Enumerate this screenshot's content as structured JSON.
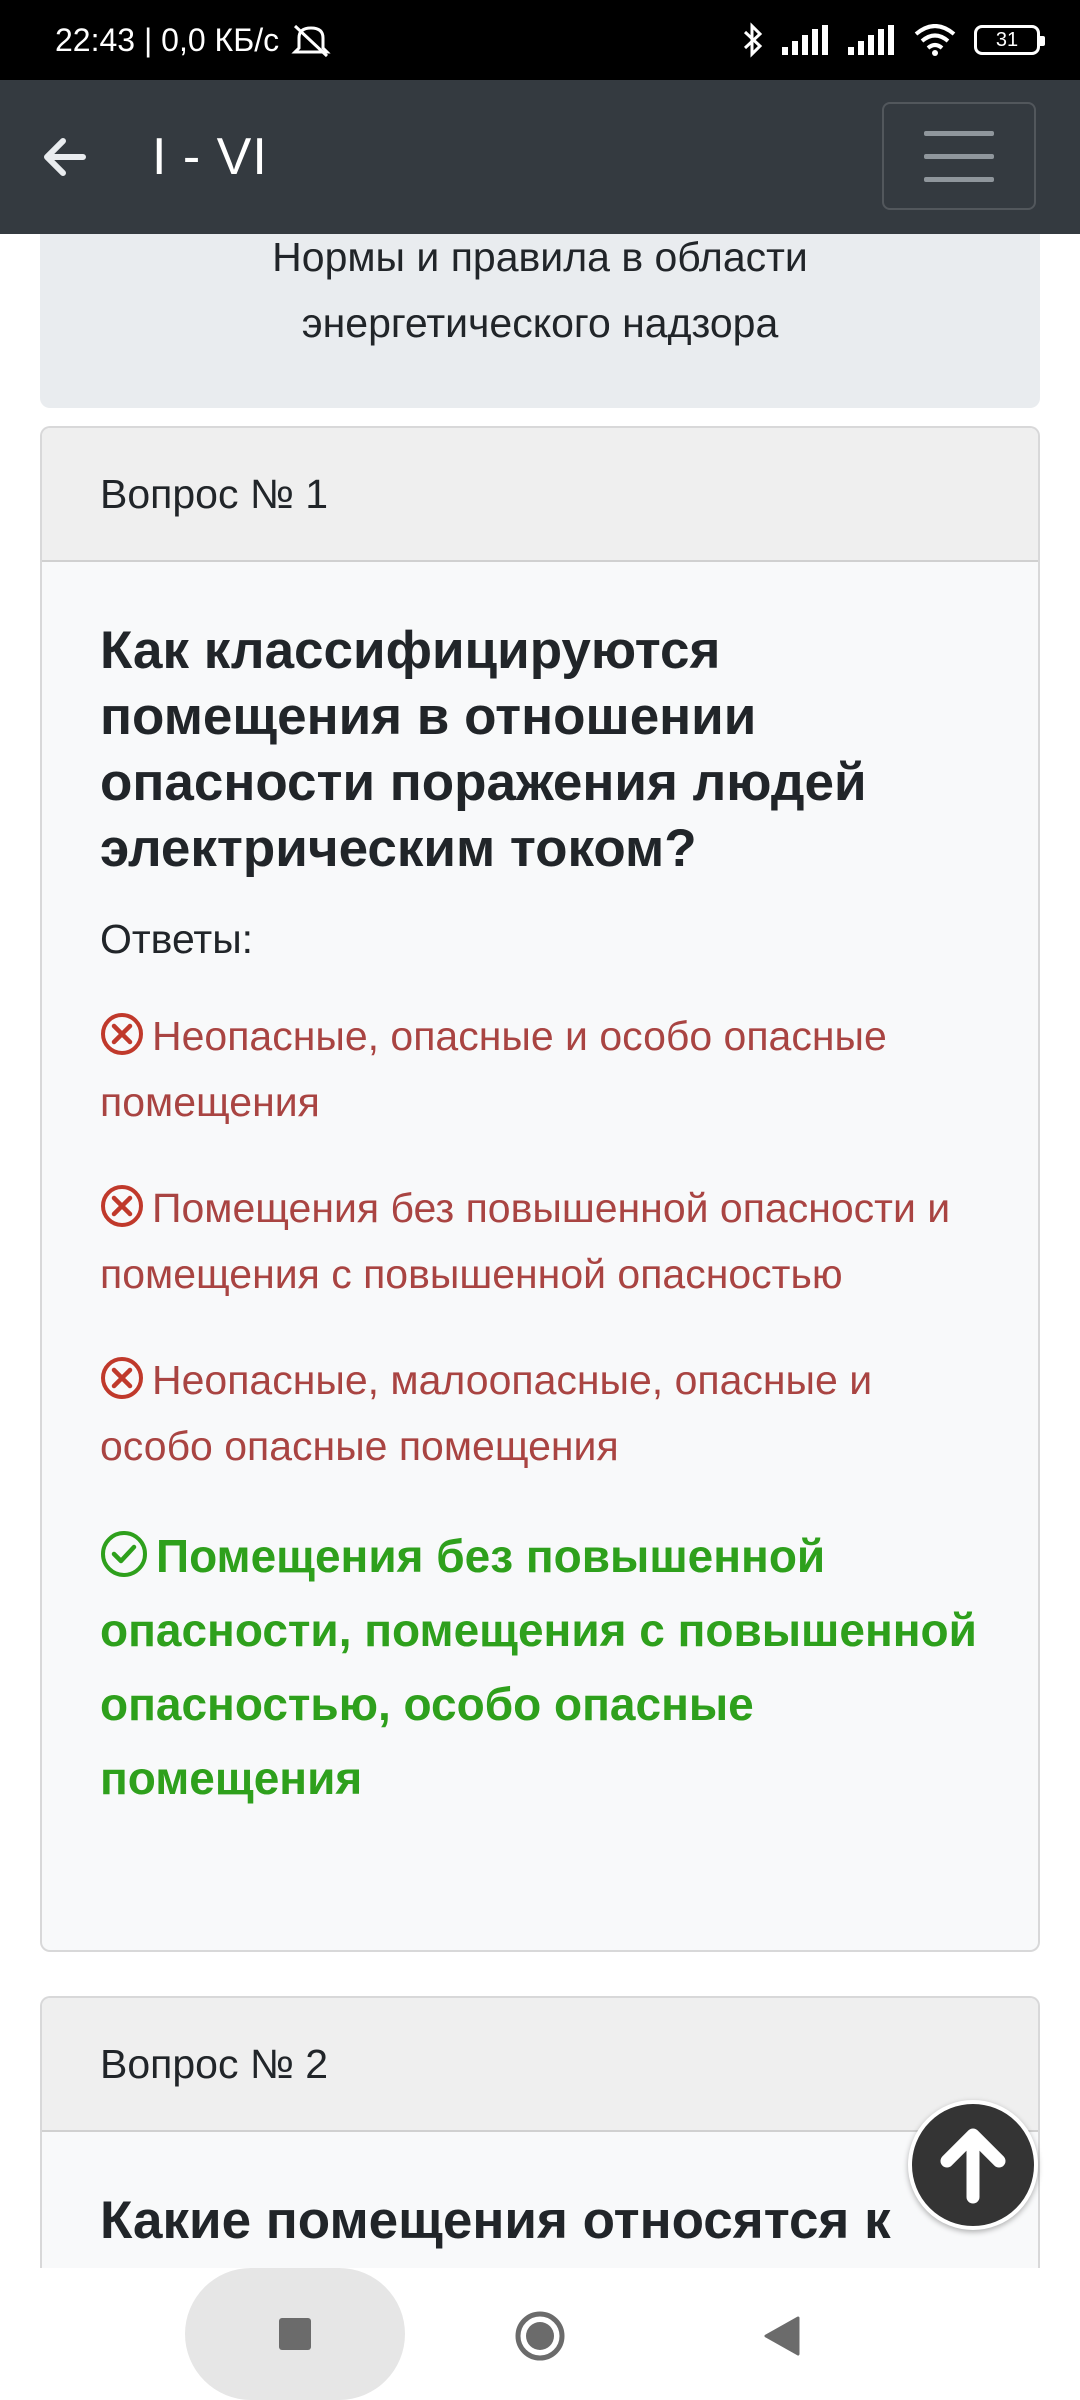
{
  "status_bar": {
    "time_speed": "22:43 | 0,0 КБ/с",
    "battery": "31"
  },
  "app_bar": {
    "title": "I - VI"
  },
  "section": {
    "line1": "Нормы и правила в области",
    "line2": "энергетического надзора"
  },
  "questions": [
    {
      "header": "Вопрос № 1",
      "text": "Как классифицируются помещения в отношении опасности поражения людей электрическим током?",
      "answers_label": "Ответы:",
      "wrong": [
        "Неопасные, опасные и особо опасные помещения",
        "Помещения без повышенной опасности и помещения с повышенной опасностью",
        "Неопасные, малоопасные, опасные и особо опасные помещения"
      ],
      "correct": "Помещения без повышенной опасности, помещения с повышенной опасностью, особо опасные помещения"
    },
    {
      "header": "Вопрос № 2",
      "text": "Какие помещения относятся к"
    }
  ],
  "colors": {
    "app_bar": "#343a40",
    "wrong": "#a94442",
    "correct": "#2ea01c"
  },
  "icons": {
    "back": "arrow-left-icon",
    "menu": "hamburger-icon",
    "wrong": "x-circle-icon",
    "correct": "check-circle-icon",
    "scroll_top": "arrow-up-icon"
  }
}
